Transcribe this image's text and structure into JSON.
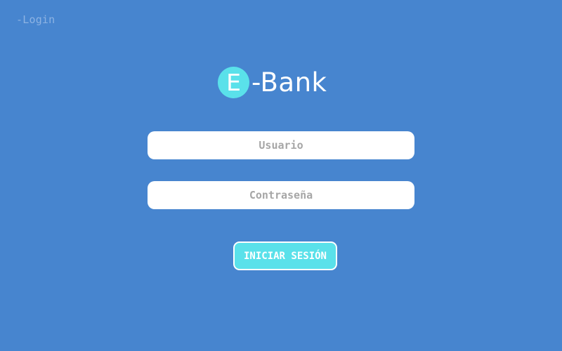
{
  "page": {
    "label": "-Login"
  },
  "brand": {
    "letter": "E",
    "rest": "-Bank"
  },
  "form": {
    "username": {
      "placeholder": "Usuario",
      "value": ""
    },
    "password": {
      "placeholder": "Contraseña",
      "value": ""
    },
    "submit_label": "INICIAR SESIÓN"
  },
  "colors": {
    "background": "#4785cf",
    "accent": "#5ae1ea",
    "field_background": "#ffffff",
    "placeholder": "#a6a6a6",
    "page_label": "#8db3e3"
  }
}
